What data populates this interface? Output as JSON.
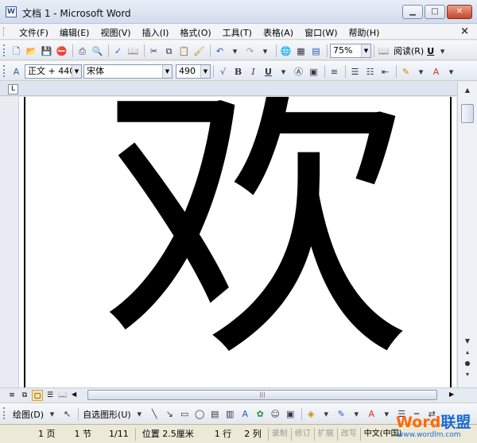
{
  "window": {
    "title": "文档 1 - Microsoft Word",
    "doc_close": "×"
  },
  "menu": [
    "文件(F)",
    "编辑(E)",
    "视图(V)",
    "插入(I)",
    "格式(O)",
    "工具(T)",
    "表格(A)",
    "窗口(W)",
    "帮助(H)"
  ],
  "standard_toolbar": {
    "zoom": "75%",
    "read_label": "阅读(R)"
  },
  "format_toolbar": {
    "style": "正文 + 440",
    "font": "宋体",
    "size": "490",
    "bold": "B",
    "italic": "I",
    "underline": "U",
    "font_color": "A"
  },
  "document": {
    "content": "欢"
  },
  "draw_toolbar": {
    "draw_label": "绘图(D)",
    "autoshape_label": "自选图形(U)"
  },
  "statusbar": {
    "page": "1 页",
    "section": "1 节",
    "page_of": "1/11",
    "position": "位置 2.5厘米",
    "line": "1 行",
    "column": "2 列",
    "rec": "录制",
    "trk": "修订",
    "ext": "扩展",
    "ovr": "改写",
    "language": "中文(中国)"
  },
  "watermark": {
    "brand_a": "Word",
    "brand_b": "联盟",
    "url": "www.wordlm.com"
  }
}
